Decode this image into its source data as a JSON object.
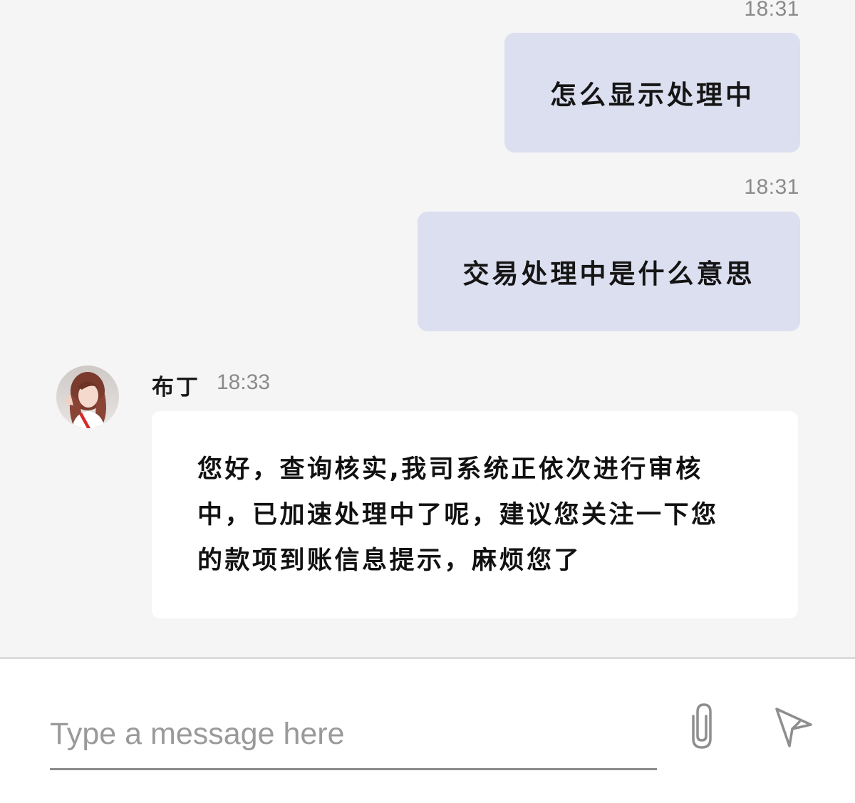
{
  "messages": {
    "outgoing": [
      {
        "time": "18:31",
        "text": "怎么显示处理中"
      },
      {
        "time": "18:31",
        "text": "交易处理中是什么意思"
      }
    ],
    "incoming": {
      "sender": "布丁",
      "time": "18:33",
      "lines": [
        "您好，查询核实,我司系统正依次进行审核",
        "中，已加速处理中了呢，建议您关注一下您",
        "的款项到账信息提示，麻烦您了"
      ]
    }
  },
  "composer": {
    "placeholder": "Type a message here",
    "attach_icon": "paperclip-icon",
    "send_icon": "send-icon"
  },
  "colors": {
    "chat_background": "#f5f5f5",
    "outgoing_bubble": "#dcdff0",
    "incoming_bubble": "#ffffff",
    "timestamp": "#8a8a8a"
  }
}
